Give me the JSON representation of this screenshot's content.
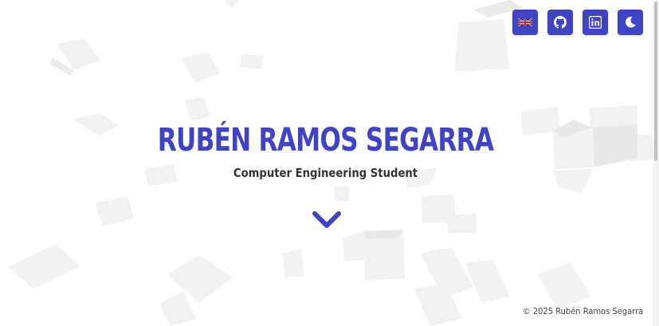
{
  "theme": {
    "accent": "#3e44c4",
    "text": "#333333",
    "background": "#ffffff"
  },
  "toolbar": {
    "buttons": [
      {
        "icon": "uk-flag-icon",
        "name": "language-button"
      },
      {
        "icon": "github-icon",
        "name": "github-button"
      },
      {
        "icon": "linkedin-icon",
        "name": "linkedin-button"
      },
      {
        "icon": "moon-icon",
        "name": "theme-toggle-button"
      }
    ]
  },
  "hero": {
    "name": "RUBÉN RAMOS SEGARRA",
    "subtitle": "Computer Engineering Student",
    "scroll_icon": "chevron-down-icon"
  },
  "footer": {
    "copyright": "© 2025 Rubén Ramos Segarra"
  }
}
